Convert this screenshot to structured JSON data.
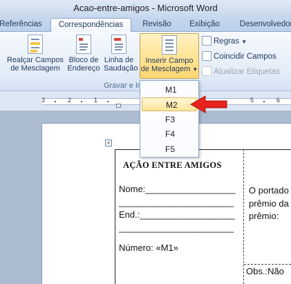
{
  "window": {
    "title": "Acao-entre-amigos - Microsoft Word"
  },
  "tabs": [
    {
      "label": "Referências"
    },
    {
      "label": "Correspondências",
      "active": true
    },
    {
      "label": "Revisão"
    },
    {
      "label": "Exibição"
    },
    {
      "label": "Desenvolvedor"
    }
  ],
  "ribbon": {
    "buttons": [
      {
        "line1": "Realçar Campos",
        "line2": "de Mesclagem"
      },
      {
        "line1": "Bloco de",
        "line2": "Endereço"
      },
      {
        "line1": "Linha de",
        "line2": "Saudação"
      },
      {
        "line1": "Inserir Campo",
        "line2": "de Mesclagem"
      }
    ],
    "small_items": [
      {
        "label": "Regras"
      },
      {
        "label": "Coincidir Campos"
      },
      {
        "label": "Atualizar Etiquetas",
        "disabled": true
      }
    ],
    "group_label": "Gravar e In"
  },
  "ruler": {
    "numbers": [
      "3",
      "2",
      "1",
      "5",
      "6"
    ]
  },
  "dropdown": {
    "items": [
      "M1",
      "M2",
      "F3",
      "F4",
      "F5"
    ],
    "selected_index": 1
  },
  "document": {
    "card_title": "AÇÃO ENTRE AMIGOS",
    "nome": "Nome:__________________",
    "blank1": "_______________________",
    "endereco": "End.:___________________",
    "blank2": "_______________________",
    "numero": "Número: «M1»",
    "right_lines": [
      "O portado",
      "prêmio da",
      "prêmio:"
    ],
    "obs": "Obs.:Não"
  },
  "colors": {
    "arrow": "#e8231e",
    "highlight": "#ffd771"
  }
}
